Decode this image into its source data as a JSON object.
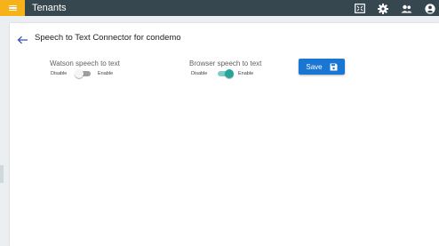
{
  "header": {
    "title": "Tenants",
    "menu_icon": "hamburger-menu-icon",
    "actions": [
      {
        "icon": "fullscreen-icon"
      },
      {
        "icon": "gear-icon"
      },
      {
        "icon": "people-icon"
      },
      {
        "icon": "account-circle-icon"
      }
    ],
    "colors": {
      "bar": "#37474f",
      "menu_button": "#f5b21a"
    }
  },
  "page": {
    "title": "Speech to Text Connector for condemo",
    "back_icon": "arrow-back-icon"
  },
  "settings": {
    "watson": {
      "label": "Watson speech to text",
      "off_label": "Disable",
      "on_label": "Enable",
      "enabled": false
    },
    "browser": {
      "label": "Browser speech to text",
      "off_label": "Disable",
      "on_label": "Enable",
      "enabled": true,
      "accent_color": "#26a69a"
    }
  },
  "actions": {
    "save_label": "Save",
    "save_icon": "floppy-disk-icon",
    "save_color": "#1976d2"
  }
}
